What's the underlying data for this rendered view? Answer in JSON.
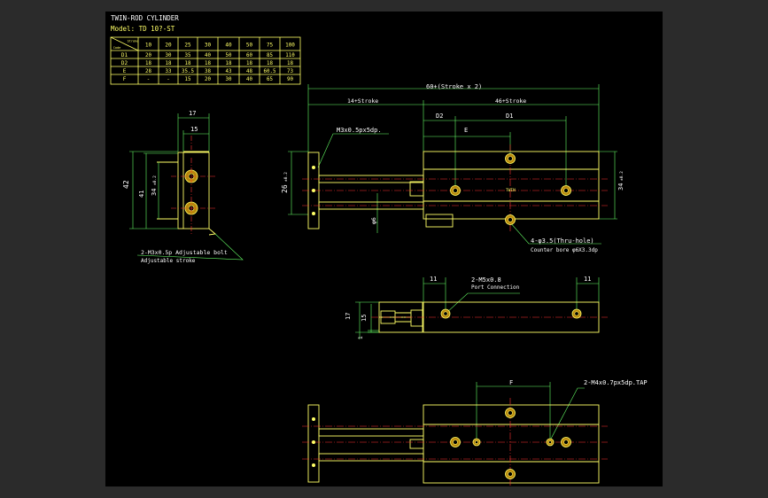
{
  "drawing": {
    "title": "TWIN-ROD CYLINDER",
    "model": "Model: TD 10?-ST",
    "table": {
      "corner_top": "Stroke",
      "corner_bottom": "Code",
      "headers": [
        "10",
        "20",
        "25",
        "30",
        "40",
        "50",
        "75",
        "100"
      ],
      "rows": [
        {
          "code": "D1",
          "values": [
            "20",
            "30",
            "35",
            "40",
            "50",
            "60",
            "85",
            "110"
          ]
        },
        {
          "code": "D2",
          "values": [
            "18",
            "18",
            "18",
            "18",
            "18",
            "18",
            "18",
            "18"
          ]
        },
        {
          "code": "E",
          "values": [
            "28",
            "33",
            "35.5",
            "38",
            "43",
            "48",
            "60.5",
            "73"
          ]
        },
        {
          "code": "F",
          "values": [
            "-",
            "-",
            "15",
            "20",
            "30",
            "40",
            "65",
            "90"
          ]
        }
      ]
    },
    "dims": {
      "overall": "60+(Stroke x 2)",
      "left_seg": "14+Stroke",
      "right_seg": "46+Stroke",
      "d2": "D2",
      "d1": "D1",
      "e": "E",
      "tap_top": "M3x0.5px5dp.",
      "height26": "26",
      "tol26": "±0.2",
      "dia6": "φ6",
      "height34": "34",
      "tol34": "±0.2",
      "thru": "4-φ3.5(Thru-hole)",
      "counter": "Counter bore φ6X3.3dp",
      "w17": "17",
      "w15": "15",
      "h42": "42",
      "h41": "41",
      "h34": "34",
      "tol_side": "±0.2",
      "adj1": "2-M3x0.5p Adjustable bolt",
      "adj2": "Adjustable stroke",
      "v11a": "11",
      "v11b": "11",
      "port": "2-M5x0.8",
      "port2": "Port Connection",
      "v17": "17",
      "v15": "15",
      "v1": "1",
      "f": "F",
      "tap_bottom": "2-M4x0.7px5dp.TAP",
      "mark": "TWIN"
    },
    "colors": {
      "background": "#000000",
      "outline": "#ffff66",
      "dimension": "#66ff66",
      "center": "#ff3333",
      "text": "#ffffff"
    }
  }
}
